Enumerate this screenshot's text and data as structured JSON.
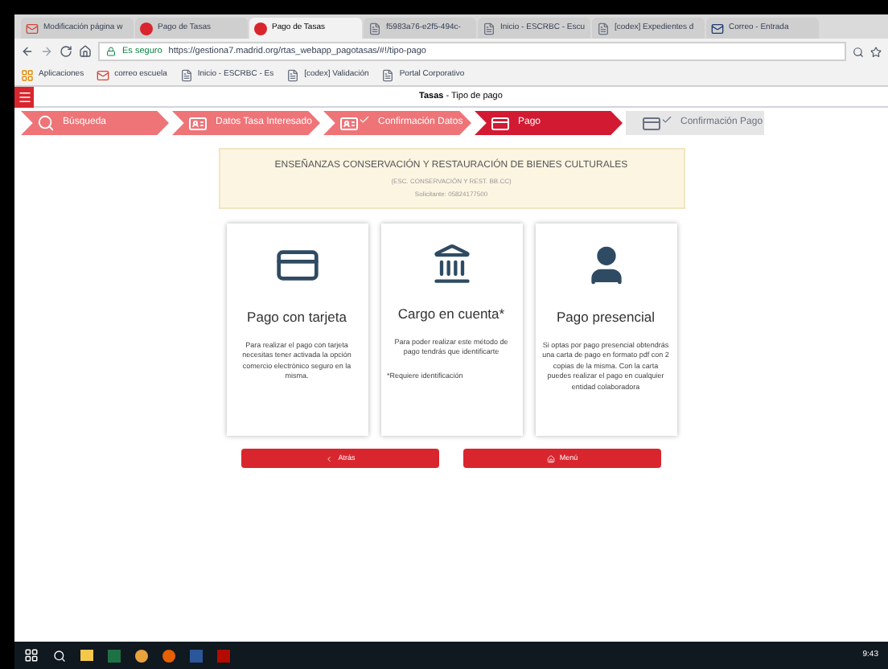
{
  "browser": {
    "tabs": [
      {
        "label": "Modificación página w",
        "selected": false,
        "kind": "mail"
      },
      {
        "label": "Pago de Tasas",
        "selected": false,
        "kind": "red"
      },
      {
        "label": "Pago de Tasas",
        "selected": true,
        "kind": "red"
      },
      {
        "label": "f5983a76-e2f5-494c-",
        "selected": false,
        "kind": "doc"
      },
      {
        "label": "Inicio - ESCRBC - Escu",
        "selected": false,
        "kind": "doc"
      },
      {
        "label": "[codex] Expedientes d",
        "selected": false,
        "kind": "doc"
      },
      {
        "label": "Correo - Entrada",
        "selected": false,
        "kind": "mail2"
      }
    ],
    "security": "Es seguro",
    "url": "https://gestiona7.madrid.org/rtas_webapp_pagotasas/#!/tipo-pago",
    "bookmarks": [
      {
        "label": "Aplicaciones",
        "kind": "apps"
      },
      {
        "label": "correo escuela",
        "kind": "mail"
      },
      {
        "label": "Inicio - ESCRBC - Es",
        "kind": "doc"
      },
      {
        "label": "[codex] Validación",
        "kind": "doc"
      },
      {
        "label": "Portal Corporativo",
        "kind": "doc"
      }
    ]
  },
  "header": {
    "title_bold": "Tasas",
    "title_rest": " - Tipo de pago"
  },
  "steps": [
    {
      "label": "Búsqueda",
      "selected": false,
      "kind": "search"
    },
    {
      "label": "Datos Tasa Interesado",
      "selected": false,
      "kind": "form"
    },
    {
      "label": "Confirmación Datos",
      "selected": false,
      "kind": "formcheck"
    },
    {
      "label": "Pago",
      "selected": true,
      "kind": "card"
    },
    {
      "label": "Confirmación Pago",
      "selected": false,
      "kind": "cardcheck"
    }
  ],
  "info": {
    "title": "ENSEÑANZAS CONSERVACIÓN Y RESTAURACIÓN DE BIENES CULTURALES",
    "line_1": "(ESC. CONSERVACIÓN Y REST. BB.CC)",
    "line_2": "Solicitante: 05824177500"
  },
  "options": [
    {
      "kind": "card",
      "title": "Pago con tarjeta",
      "text": "Para realizar el pago con tarjeta necesitas tener activada la opción comercio electrónico seguro en la misma."
    },
    {
      "kind": "bank",
      "title": "Cargo en cuenta*",
      "text": "Para poder realizar este método de pago tendrás que identificarte",
      "note": "*Requiere identificación"
    },
    {
      "kind": "person",
      "title": "Pago presencial",
      "text": "Si optas por pago presencial obtendrás una carta de pago en formato pdf con 2 copias de la misma. Con la carta puedes realizar el pago en cualquier entidad colaboradora"
    }
  ],
  "buttons": [
    {
      "label": "Atrás",
      "kind": "back"
    },
    {
      "label": "Menú",
      "kind": "home"
    }
  ],
  "taskbar": {
    "time": "9:43"
  }
}
